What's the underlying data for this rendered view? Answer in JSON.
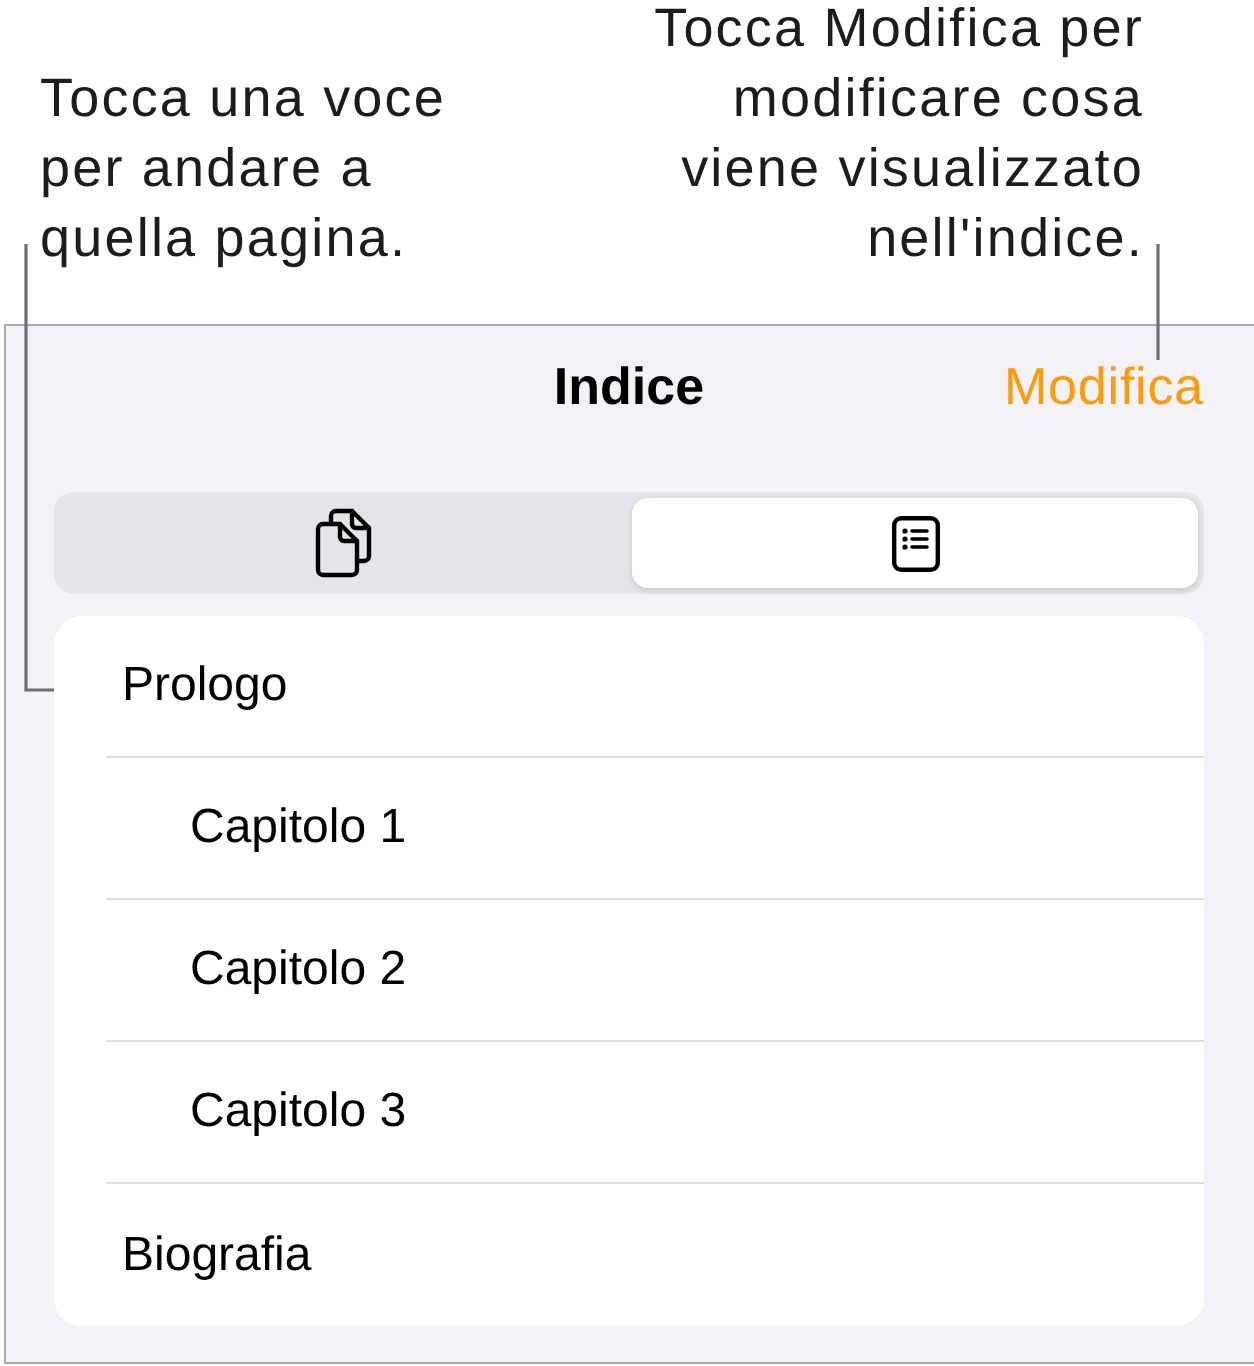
{
  "callouts": {
    "left": {
      "lines": [
        "Tocca una voce",
        "per andare a",
        "quella pagina."
      ]
    },
    "right": {
      "lines": [
        "Tocca Modifica per",
        "modificare cosa",
        "viene visualizzato",
        "nell'indice."
      ]
    }
  },
  "header": {
    "title": "Indice",
    "edit_button": "Modifica"
  },
  "segments": [
    {
      "kind": "pages",
      "selected": false
    },
    {
      "kind": "toc",
      "selected": true
    }
  ],
  "toc": {
    "items": [
      {
        "label": "Prologo",
        "children": [
          {
            "label": "Capitolo 1"
          },
          {
            "label": "Capitolo 2"
          },
          {
            "label": "Capitolo 3"
          }
        ]
      },
      {
        "label": "Biografia"
      }
    ]
  }
}
